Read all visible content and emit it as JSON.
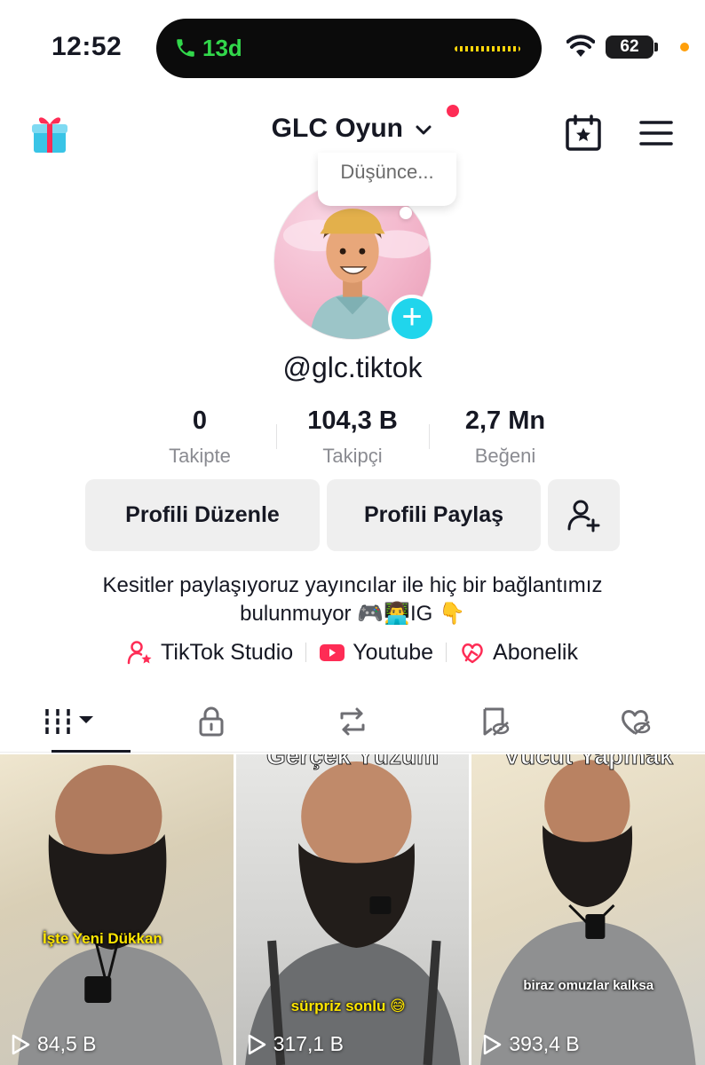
{
  "status_bar": {
    "time": "12:52",
    "call_duration": "13d",
    "battery": "62",
    "icons": [
      "phone-icon",
      "waveform-icon",
      "wifi-icon",
      "battery-icon"
    ]
  },
  "header": {
    "account_name": "GLC Oyun",
    "icons": [
      "gift-icon",
      "chevron-down-icon",
      "calendar-star-icon",
      "menu-icon"
    ]
  },
  "profile": {
    "thought_bubble": "Düşünce...",
    "username": "@glc.tiktok",
    "stats": [
      {
        "value": "0",
        "label": "Takipte"
      },
      {
        "value": "104,3 B",
        "label": "Takipçi"
      },
      {
        "value": "2,7 Mn",
        "label": "Beğeni"
      }
    ],
    "buttons": {
      "edit": "Profili Düzenle",
      "share": "Profili Paylaş"
    },
    "bio_line1": "Kesitler paylaşıyoruz yayıncılar ile hiç bir bağlantımız",
    "bio_line2": "bulunmuyor 🎮👨‍💻IG 👇",
    "links": [
      {
        "label": "TikTok Studio",
        "icon": "person-star-icon"
      },
      {
        "label": "Youtube",
        "icon": "youtube-icon"
      },
      {
        "label": "Abonelik",
        "icon": "subscription-icon"
      }
    ]
  },
  "tabs": [
    "videos-grid-icon",
    "lock-icon",
    "repost-icon",
    "favorites-hidden-icon",
    "liked-hidden-icon"
  ],
  "videos": [
    {
      "title": "",
      "caption": "İşte Yeni Dükkan",
      "views": "84,5 B"
    },
    {
      "title": "Gerçek Yüzüm",
      "caption": "sürpriz sonlu 😅",
      "views": "317,1 B"
    },
    {
      "title": "\"Vücut Yapmak\"",
      "caption": "biraz omuzlar kalksa",
      "views": "393,4 B"
    }
  ],
  "colors": {
    "accent_red": "#fe2c55",
    "add_avatar": "#20d5ec",
    "call_green": "#32d74b",
    "button_bg": "#efefef"
  }
}
